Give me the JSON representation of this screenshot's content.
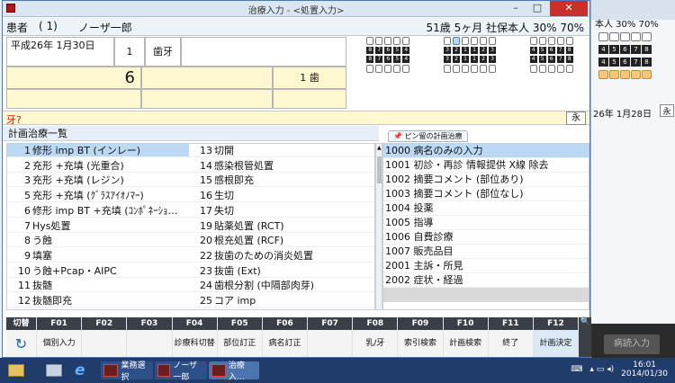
{
  "window": {
    "title": "治療入力 - <処置入力>",
    "min": "–",
    "max": "□",
    "close": "✕"
  },
  "patient": {
    "label": "患者",
    "id": "(      1)",
    "name": "ノーザ一郎",
    "info": "51歳 5ヶ月 社保本人   30%  70%"
  },
  "entry": {
    "date": "平成26年  1月30日",
    "count": "1",
    "kind": "歯牙",
    "amount": "6",
    "teeth_label": "1 歯"
  },
  "teeth": {
    "upper_numbers": [
      [
        "8",
        "7",
        "6",
        "5",
        "4"
      ],
      [
        "3",
        "2",
        "1",
        "1",
        "2",
        "3"
      ],
      [
        "4",
        "5",
        "6",
        "7",
        "8"
      ]
    ],
    "lower_numbers": [
      [
        "8",
        "7",
        "6",
        "5",
        "4"
      ],
      [
        "3",
        "2",
        "1",
        "1",
        "2",
        "3"
      ],
      [
        "4",
        "5",
        "6",
        "7",
        "8"
      ]
    ]
  },
  "hint": {
    "prompt": "牙?",
    "button": "永"
  },
  "plan": {
    "header": "計画治療一覧",
    "pin_tab": "ピン留の計画治療",
    "left_items": [
      {
        "n": "1",
        "label": "修形 imp BT (インレー)"
      },
      {
        "n": "2",
        "label": "充形 +充填 (光重合)"
      },
      {
        "n": "3",
        "label": "充形 +充填 (レジン)"
      },
      {
        "n": "5",
        "label": "充形 +充填 (ｸﾞﾗｽｱｲｵﾉﾏｰ)"
      },
      {
        "n": "6",
        "label": "修形 imp BT +充填 (ｺﾝﾎﾟﾈｰｼｮ…"
      },
      {
        "n": "7",
        "label": "Hys処置"
      },
      {
        "n": "8",
        "label": "う蝕"
      },
      {
        "n": "9",
        "label": "填塞"
      },
      {
        "n": "10",
        "label": "う蝕+Pcap・AIPC"
      },
      {
        "n": "11",
        "label": "抜髄"
      },
      {
        "n": "12",
        "label": "抜髄即充"
      },
      {
        "n": "13",
        "label": "切開"
      },
      {
        "n": "14",
        "label": "感染根管処置"
      },
      {
        "n": "15",
        "label": "感根即充"
      },
      {
        "n": "16",
        "label": "生切"
      },
      {
        "n": "17",
        "label": "失切"
      },
      {
        "n": "19",
        "label": "貼薬処置 (RCT)"
      },
      {
        "n": "20",
        "label": "根充処置 (RCF)"
      },
      {
        "n": "22",
        "label": "抜歯のための消炎処置"
      },
      {
        "n": "23",
        "label": "抜歯 (Ext)"
      },
      {
        "n": "24",
        "label": "歯根分割 (中隔部肉芽)"
      },
      {
        "n": "25",
        "label": "コア imp"
      }
    ],
    "right_items": [
      "1000 病名のみの入力",
      "1001 初診・再診 情報提供 X線 除去",
      "1002 摘要コメント (部位あり)",
      "1003 摘要コメント (部位なし)",
      "1004 投薬",
      "1005 指導",
      "1006 自費診療",
      "1007 販売品目",
      "2001 主訴・所見",
      "2002 症状・経過"
    ]
  },
  "fkeys": [
    {
      "key": "切替",
      "label": "↻"
    },
    {
      "key": "F01",
      "label": "個別入力"
    },
    {
      "key": "F02",
      "label": ""
    },
    {
      "key": "F03",
      "label": ""
    },
    {
      "key": "F04",
      "label": "診療科切替"
    },
    {
      "key": "F05",
      "label": "部位訂正"
    },
    {
      "key": "F06",
      "label": "病名訂正"
    },
    {
      "key": "F07",
      "label": ""
    },
    {
      "key": "F08",
      "label": "乳/牙"
    },
    {
      "key": "F09",
      "label": "索引検索"
    },
    {
      "key": "F10",
      "label": "計画検索"
    },
    {
      "key": "F11",
      "label": "終了"
    },
    {
      "key": "F12",
      "label": "計画決定"
    }
  ],
  "bg_window": {
    "head": "本人   30%  70%",
    "date": "26年 1月28日",
    "btn": "永",
    "dark_btn": "病読入力"
  },
  "taskbar": {
    "apps": [
      "業務選択",
      "ノーザ一郎",
      "治療入…"
    ],
    "clock_time": "16:01",
    "clock_date": "2014/01/30"
  }
}
